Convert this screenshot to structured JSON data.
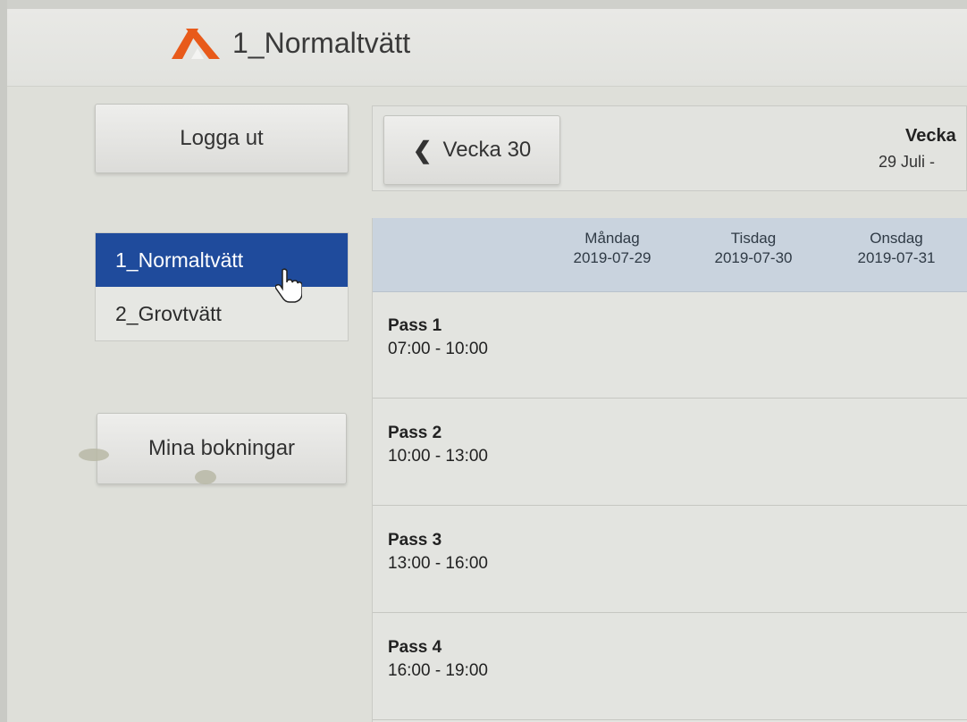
{
  "header": {
    "title": "1_Normaltvätt",
    "logo_icon": "logo-icon",
    "logo_color": "#e85a1a"
  },
  "sidebar": {
    "logout_label": "Logga ut",
    "machines": [
      {
        "label": "1_Normaltvätt",
        "active": true
      },
      {
        "label": "2_Grovtvätt",
        "active": false
      }
    ],
    "bookings_label": "Mina bokningar",
    "active_color": "#1f4b9c"
  },
  "week_nav": {
    "prev_label": "Vecka 30",
    "current_week": "Vecka",
    "current_range": "29 Juli - "
  },
  "schedule": {
    "days": [
      {
        "name": "Måndag",
        "date": "2019-07-29"
      },
      {
        "name": "Tisdag",
        "date": "2019-07-30"
      },
      {
        "name": "Onsdag",
        "date": "2019-07-31"
      }
    ],
    "passes": [
      {
        "name": "Pass 1",
        "time": "07:00 - 10:00"
      },
      {
        "name": "Pass 2",
        "time": "10:00 - 13:00"
      },
      {
        "name": "Pass 3",
        "time": "13:00 - 16:00"
      },
      {
        "name": "Pass 4",
        "time": "16:00 - 19:00"
      }
    ]
  }
}
